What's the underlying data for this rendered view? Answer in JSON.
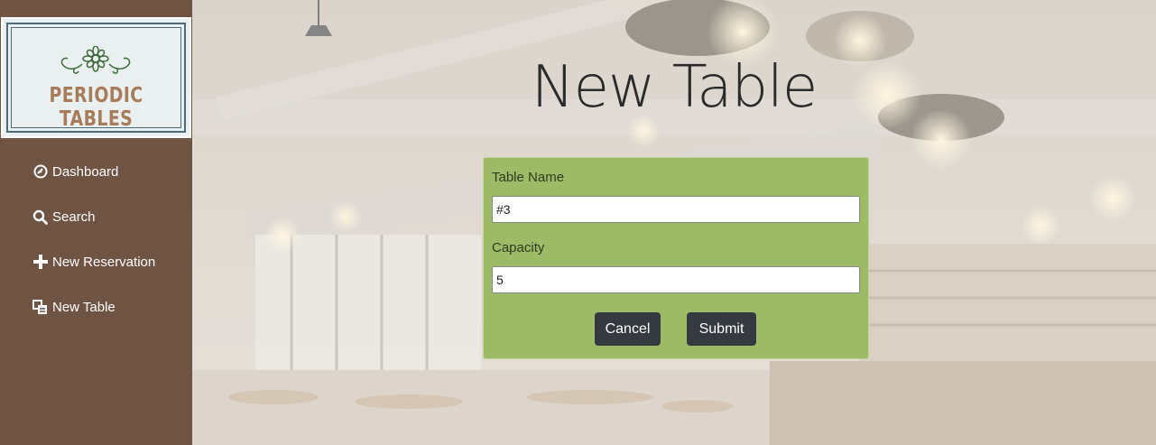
{
  "brand": {
    "logo_text": "PERIODIC TABLES"
  },
  "sidebar": {
    "items": [
      {
        "label": "Dashboard",
        "icon": "dashboard-icon"
      },
      {
        "label": "Search",
        "icon": "search-icon"
      },
      {
        "label": "New Reservation",
        "icon": "plus-icon"
      },
      {
        "label": "New Table",
        "icon": "tables-icon"
      }
    ]
  },
  "page": {
    "title": "New Table"
  },
  "form": {
    "table_name": {
      "label": "Table Name",
      "value": "#3"
    },
    "capacity": {
      "label": "Capacity",
      "value": "5"
    },
    "cancel_label": "Cancel",
    "submit_label": "Submit"
  },
  "colors": {
    "sidebar": "#6f5444",
    "card": "#9dbb66",
    "button": "#343a40",
    "logo_text": "#a67c5a",
    "logo_border": "#4b6b78"
  }
}
